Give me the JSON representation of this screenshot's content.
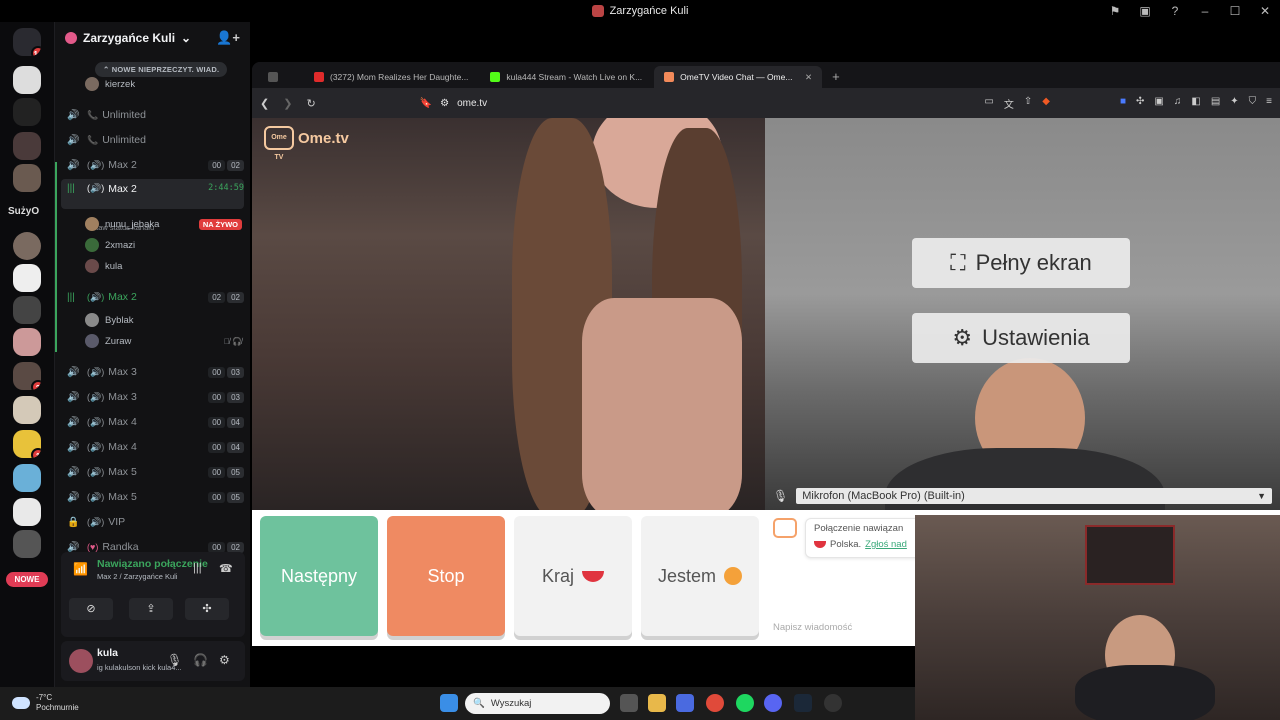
{
  "window": {
    "title": "Zarzygańce Kuli"
  },
  "rail": {
    "badge_top": "14",
    "text_item": "SużyO",
    "badge_item1": "2",
    "badge_item2": "1",
    "new_label": "NOWE"
  },
  "server": {
    "name": "Zarzygańce Kuli",
    "new_messages": "NOWE NIEPRZECZYT. WIAD."
  },
  "channels": [
    {
      "label": "kierzek"
    },
    {
      "label": "Unlimited"
    },
    {
      "label": "Unlimited"
    },
    {
      "label": "Max 2",
      "c1": "00",
      "c2": "02"
    },
    {
      "label": "Max 2",
      "timer": "2:44:59",
      "status": "Ustaw status kanału"
    },
    {
      "label": "Max 2",
      "c1": "02",
      "c2": "02"
    },
    {
      "label": "Max 3",
      "c1": "00",
      "c2": "03"
    },
    {
      "label": "Max 3",
      "c1": "00",
      "c2": "03"
    },
    {
      "label": "Max 4",
      "c1": "00",
      "c2": "04"
    },
    {
      "label": "Max 4",
      "c1": "00",
      "c2": "04"
    },
    {
      "label": "Max 5",
      "c1": "00",
      "c2": "05"
    },
    {
      "label": "Max 5",
      "c1": "00",
      "c2": "05"
    },
    {
      "label": "VIP"
    },
    {
      "label": "Randka",
      "c1": "00",
      "c2": "02"
    }
  ],
  "users_active": [
    {
      "name": "nunu_jebaka",
      "badge": "NA ŻYWO"
    },
    {
      "name": "2xmazi"
    },
    {
      "name": "kula"
    }
  ],
  "users_max2": [
    {
      "name": "Byblak"
    },
    {
      "name": "Zuraw"
    }
  ],
  "voice": {
    "status": "Nawiązano połączenie",
    "channel": "Max 2 / Zarzygańce Kuli"
  },
  "user": {
    "name": "kula",
    "activity": "ig kulakulson kick kula4..."
  },
  "browser": {
    "tabs": [
      {
        "label": "(3272) Mom Realizes Her Daughte..."
      },
      {
        "label": "kula444 Stream - Watch Live on K..."
      },
      {
        "label": "OmeTV Video Chat — Ome..."
      }
    ],
    "url": "ome.tv"
  },
  "ome": {
    "logo": "Ome.tv",
    "logo_mark": "Ome TV",
    "fullscreen": "Pełny ekran",
    "settings": "Ustawienia",
    "mic": "Mikrofon (MacBook Pro) (Built-in)",
    "btn_next": "Następny",
    "btn_stop": "Stop",
    "btn_country": "Kraj",
    "btn_me": "Jestem",
    "chat_line1": "Połączenie nawiązan",
    "chat_country": "Polska.",
    "chat_report": "Zgłoś nad",
    "chat_placeholder": "Napisz wiadomość"
  },
  "taskbar": {
    "temp": "-7°C",
    "weather": "Pochmurnie",
    "search": "Wyszukaj"
  }
}
